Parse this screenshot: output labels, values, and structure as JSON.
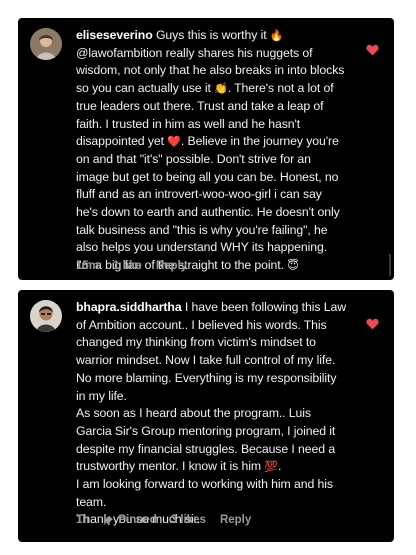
{
  "comments": [
    {
      "username": "eliseseverino",
      "segments": [
        "Guys this is worthy it ",
        "@lawofambition really shares his nuggets of wisdom, not only that he also breaks in into blocks so you can actually use it ",
        ". There's not a lot of true leaders out there. Trust and take a leap of faith. I trusted in him as well and he hasn't disappointed yet ",
        ". Believe in the journey you're on and that \"it's\" possible. Don't strive for an image but get to being all you can be. Honest, no fluff and as an introvert-woo-woo-girl i can say he's down to earth and authentic. He doesn't only talk business and \"this is why you're failing\", he also helps you understand WHY its happening. I'm a big fan of the straight to the point. "
      ],
      "emojis": [
        "🔥",
        "👏",
        "❤️",
        "😇"
      ],
      "time": "15m",
      "likes": "1 like",
      "reply_label": "Reply",
      "liked": true
    },
    {
      "username": "bhapra.siddhartha",
      "segments": [
        "I have been following this Law of Ambition account.. I believed his words. This changed my thinking from victim's mindset to  warrior mindset. Now I take full control of my life. No more blaming. Everything is my responsibility in my life.",
        "As soon as I heard about the program.. Luis Garcia Sir's Group mentoring program, I joined it despite my financial struggles. Because I need a trustworthy mentor. I know it is him ",
        ".",
        "I am looking forward to working with him and his team.",
        "Thank you so much sir."
      ],
      "emojis": [
        "💯"
      ],
      "time": "1h",
      "pinned_label": "Pinned",
      "likes": "3 likes",
      "reply_label": "Reply",
      "liked": true
    }
  ],
  "colors": {
    "heart": "#ed4956",
    "background": "#000000",
    "text": "#f1f1f1",
    "meta": "#9a9a9a"
  }
}
